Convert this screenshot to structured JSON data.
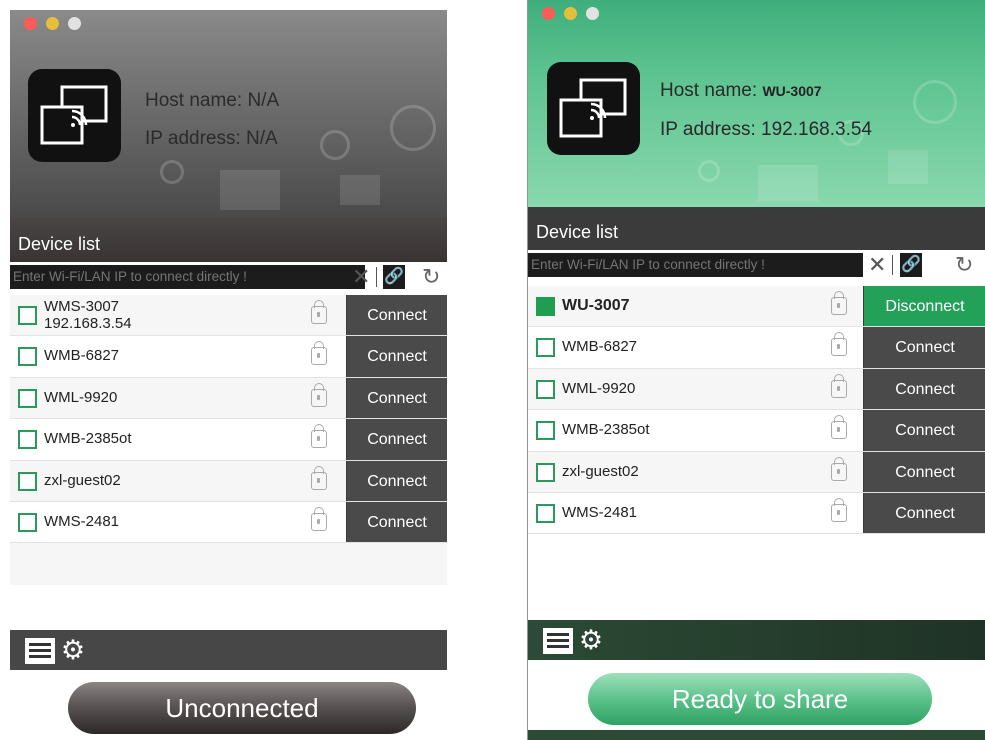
{
  "left_window": {
    "host_label": "Host name:",
    "host_value": "N/A",
    "ip_label": "IP address:",
    "ip_value": "N/A",
    "device_list_title": "Device list",
    "ip_input_placeholder": "Enter Wi-Fi/LAN IP to connect directly !",
    "devices": [
      {
        "name": "WMS-3007",
        "sub": "192.168.3.54",
        "checked": false,
        "button": "Connect"
      },
      {
        "name": "WMB-6827",
        "checked": false,
        "button": "Connect"
      },
      {
        "name": "WML-9920",
        "checked": false,
        "button": "Connect"
      },
      {
        "name": "WMB-2385ot",
        "checked": false,
        "button": "Connect"
      },
      {
        "name": "zxl-guest02",
        "checked": false,
        "button": "Connect"
      },
      {
        "name": "WMS-2481",
        "checked": false,
        "button": "Connect"
      }
    ],
    "status_button": "Unconnected"
  },
  "right_window": {
    "host_label": "Host name:",
    "host_value": "WU-3007",
    "ip_label": "IP address:",
    "ip_value": "192.168.3.54",
    "device_list_title": "Device list",
    "ip_input_placeholder": "Enter Wi-Fi/LAN IP to connect directly !",
    "devices": [
      {
        "name": "WU-3007",
        "checked": true,
        "button": "Disconnect"
      },
      {
        "name": "WMB-6827",
        "checked": false,
        "button": "Connect"
      },
      {
        "name": "WML-9920",
        "checked": false,
        "button": "Connect"
      },
      {
        "name": "WMB-2385ot",
        "checked": false,
        "button": "Connect"
      },
      {
        "name": "zxl-guest02",
        "checked": false,
        "button": "Connect"
      },
      {
        "name": "WMS-2481",
        "checked": false,
        "button": "Connect"
      }
    ],
    "status_button": "Ready to share"
  },
  "colors": {
    "accent_green": "#23a159",
    "button_dark": "#4a4a4a",
    "header_left": "#6d6d6d",
    "header_right": "#5cc390"
  },
  "icons": {
    "clear": "close-icon",
    "link": "link-icon",
    "refresh": "refresh-icon",
    "lock": "lock-icon",
    "list": "list-icon",
    "settings": "gear-icon",
    "app": "screen-cast-icon"
  }
}
